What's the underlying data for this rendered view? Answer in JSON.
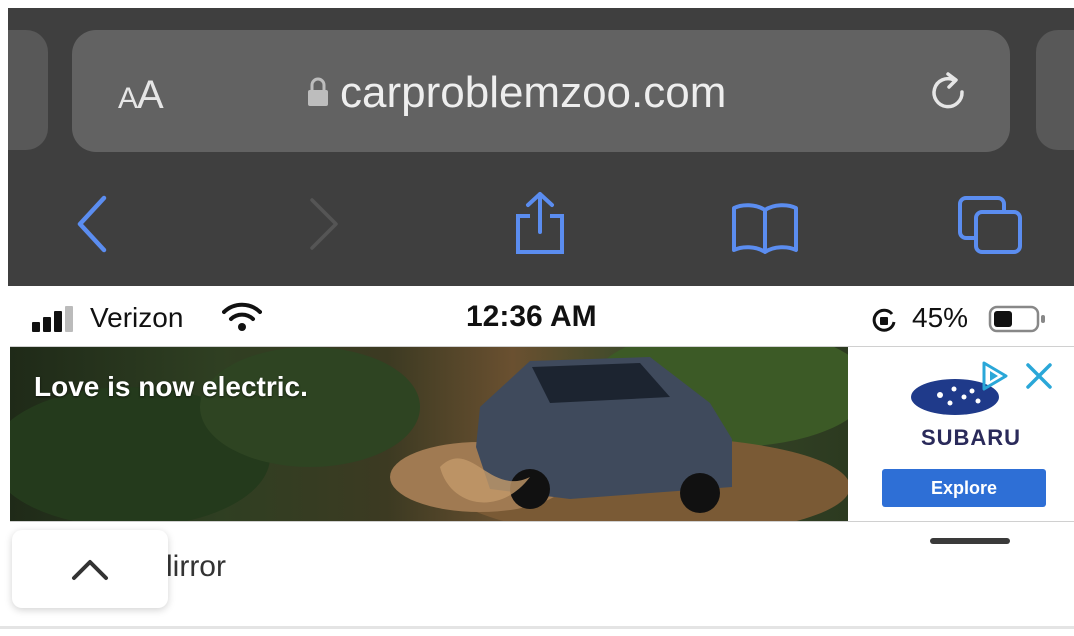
{
  "browser": {
    "text_size_label_small": "A",
    "text_size_label_large": "A",
    "url": "carproblemzoo.com",
    "toolbar_icons": [
      "back-chevron-icon",
      "forward-chevron-icon",
      "share-icon",
      "bookmarks-book-icon",
      "tabs-icon"
    ]
  },
  "status_bar": {
    "carrier": "Verizon",
    "time": "12:36 AM",
    "battery_percent": "45%",
    "battery_level": 0.45
  },
  "ad": {
    "headline": "Love is now electric.",
    "brand": "SUBARU",
    "cta_label": "Explore"
  },
  "page": {
    "snippet_text": "lirror"
  },
  "colors": {
    "chrome_bg": "#3f3f3f",
    "urlbar_bg": "#626262",
    "icon_blue": "#5b8df0",
    "cta_blue": "#2e6fd6"
  }
}
